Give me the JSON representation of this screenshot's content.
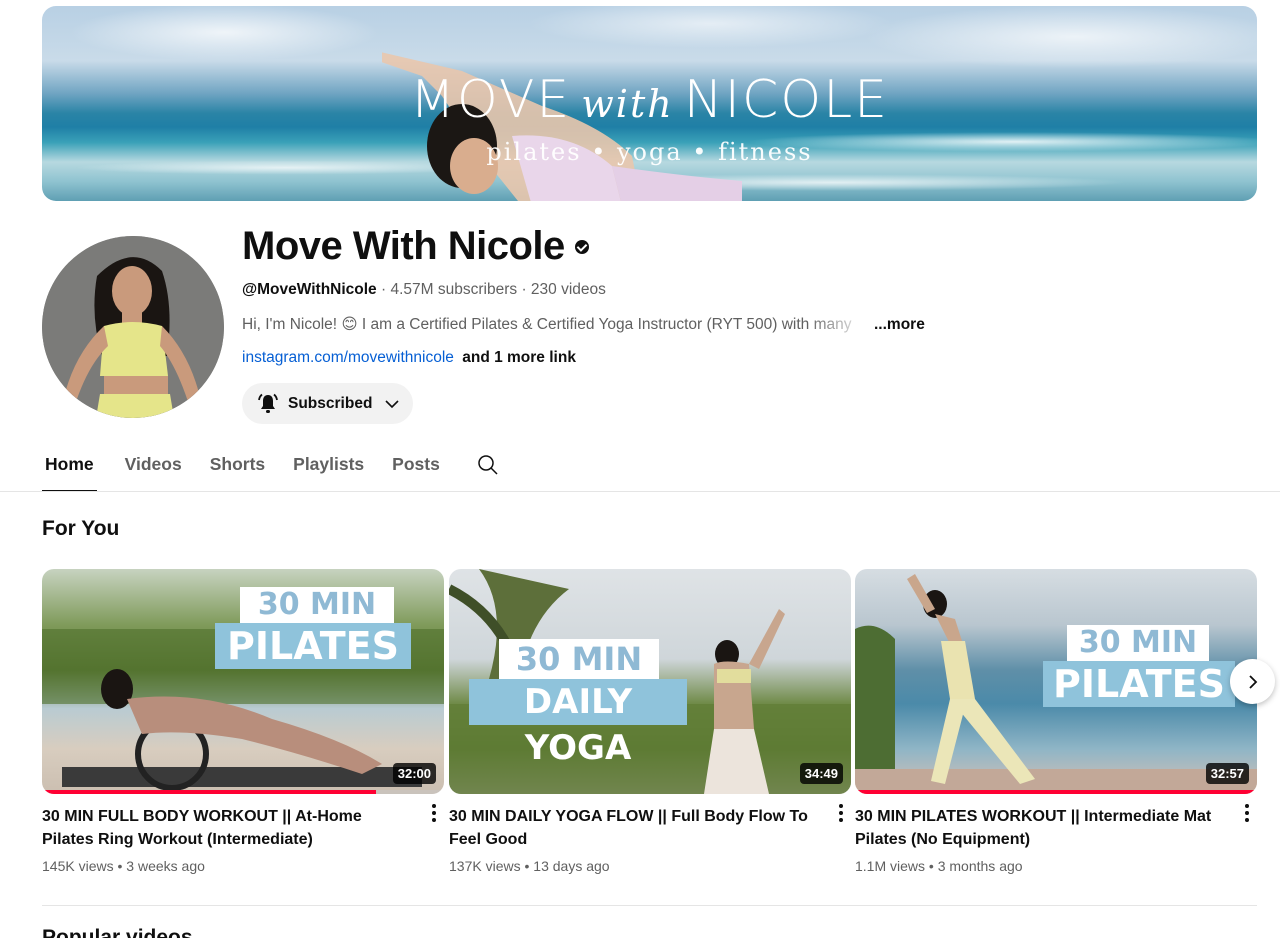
{
  "banner": {
    "title_left": "MOVE",
    "title_mid": "with",
    "title_right": "NICOLE",
    "subtitle": "pilates • yoga • fitness"
  },
  "channel": {
    "name": "Move With Nicole",
    "handle": "@MoveWithNicole",
    "subscribers": "4.57M subscribers",
    "videos": "230 videos",
    "separator": "·",
    "description": "Hi, I'm Nicole! 😊 I am a Certified Pilates & Certified Yoga Instructor (RYT 500) with many",
    "more_label": "...more",
    "link": "instagram.com/movewithnicole",
    "more_links": "and 1 more link",
    "subscribe_label": "Subscribed"
  },
  "tabs": [
    {
      "label": "Home"
    },
    {
      "label": "Videos"
    },
    {
      "label": "Shorts"
    },
    {
      "label": "Playlists"
    },
    {
      "label": "Posts"
    }
  ],
  "section": {
    "title": "For You",
    "next_title": "Popular videos"
  },
  "videos": [
    {
      "thumb_line1": "30 MIN",
      "thumb_line2": "PILATES",
      "duration": "32:00",
      "title": "30 MIN FULL BODY WORKOUT || At-Home Pilates Ring Workout (Intermediate)",
      "views": "145K views",
      "age": "3 weeks ago",
      "watched_fraction": 0.83
    },
    {
      "thumb_line1": "30 MIN",
      "thumb_line2": "DAILY YOGA",
      "duration": "34:49",
      "title": "30 MIN DAILY YOGA FLOW || Full Body Flow To Feel Good",
      "views": "137K views",
      "age": "13 days ago",
      "watched_fraction": 0
    },
    {
      "thumb_line1": "30 MIN",
      "thumb_line2": "PILATES",
      "duration": "32:57",
      "title": "30 MIN PILATES WORKOUT || Intermediate Mat Pilates (No Equipment)",
      "views": "1.1M views",
      "age": "3 months ago",
      "watched_fraction": 1.0
    }
  ],
  "icons": {
    "bell": "bell-ring-icon",
    "chevron": "chevron-down-icon",
    "search": "search-icon",
    "next": "chevron-right-icon",
    "verified": "verified-check-icon"
  }
}
